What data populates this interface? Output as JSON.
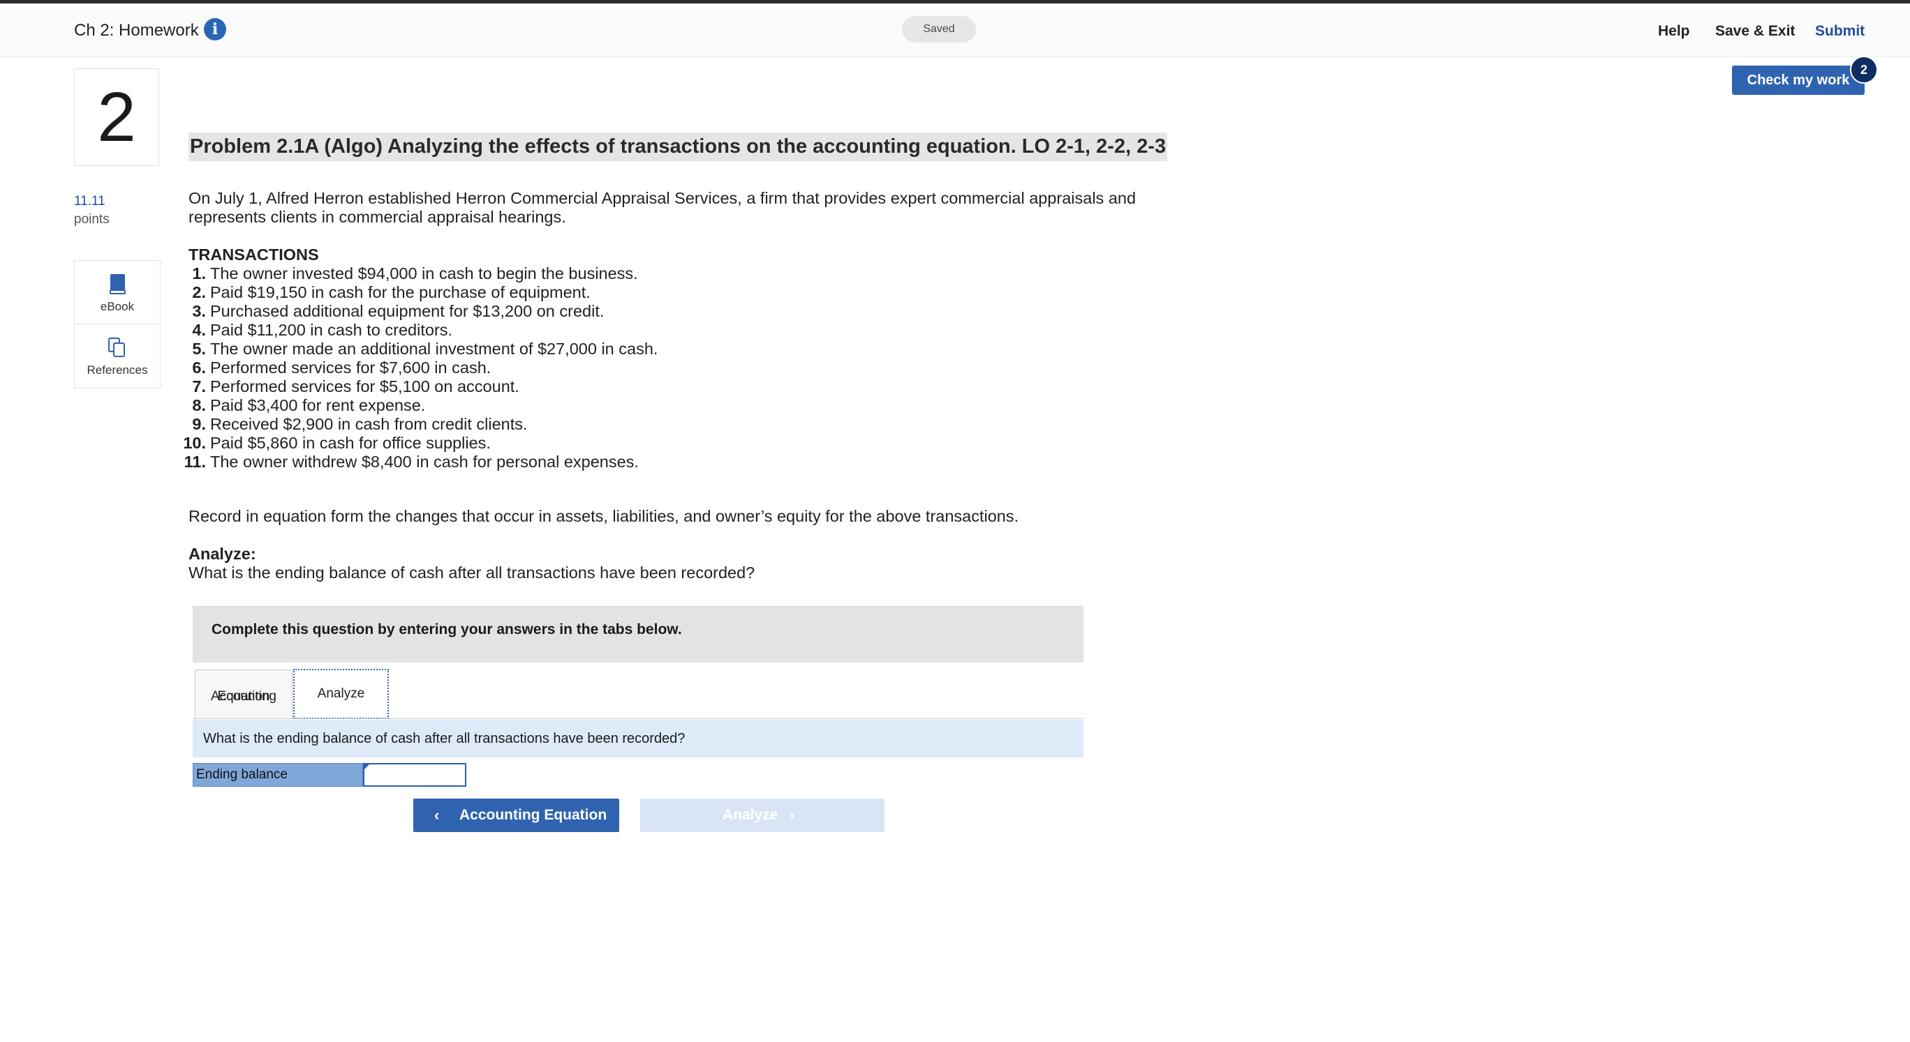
{
  "header": {
    "title": "Ch 2: Homework",
    "info_icon": "info-icon",
    "status": "Saved",
    "help": "Help",
    "save_exit": "Save & Exit",
    "submit": "Submit"
  },
  "check_work": {
    "label": "Check my work",
    "badge": "2"
  },
  "question": {
    "number": "2",
    "points_value": "11.11",
    "points_label": "points"
  },
  "resources": [
    {
      "label": "eBook",
      "icon": "book-icon"
    },
    {
      "label": "References",
      "icon": "copy-icon"
    }
  ],
  "problem": {
    "title": "Problem 2.1A (Algo) Analyzing the effects of transactions on the accounting equation. LO 2-1, 2-2, 2-3",
    "intro": "On July 1, Alfred Herron established Herron Commercial Appraisal Services, a firm that provides expert commercial appraisals and represents clients in commercial appraisal hearings.",
    "transactions_heading": "TRANSACTIONS",
    "transactions": [
      {
        "num": "1.",
        "text": "The owner invested $94,000 in cash to begin the business."
      },
      {
        "num": "2.",
        "text": "Paid $19,150 in cash for the purchase of equipment."
      },
      {
        "num": "3.",
        "text": "Purchased additional equipment for $13,200 on credit."
      },
      {
        "num": "4.",
        "text": "Paid $11,200 in cash to creditors."
      },
      {
        "num": "5.",
        "text": "The owner made an additional investment of $27,000 in cash."
      },
      {
        "num": "6.",
        "text": "Performed services for $7,600 in cash."
      },
      {
        "num": "7.",
        "text": "Performed services for $5,100 on account."
      },
      {
        "num": "8.",
        "text": "Paid $3,400 for rent expense."
      },
      {
        "num": "9.",
        "text": "Received $2,900 in cash from credit clients."
      },
      {
        "num": "10.",
        "text": "Paid $5,860 in cash for office supplies."
      },
      {
        "num": "11.",
        "text": "The owner withdrew $8,400 in cash for personal expenses."
      }
    ],
    "record_instruction": "Record in equation form the changes that occur in assets, liabilities, and owner’s equity for the above transactions.",
    "analyze_heading": "Analyze:",
    "analyze_question": "What is the ending balance of cash after all transactions have been recorded?"
  },
  "workspace": {
    "instruction": "Complete this question by entering your answers in the tabs below.",
    "tabs": [
      {
        "label_line1": "Accounting",
        "label_line2": "Equation"
      },
      {
        "label": "Analyze"
      }
    ],
    "question": "What is the ending balance of cash after all transactions have been recorded?",
    "ending_balance_label": "Ending balance",
    "ending_balance_value": "",
    "prev_button": "Accounting Equation",
    "next_button": "Analyze"
  }
}
